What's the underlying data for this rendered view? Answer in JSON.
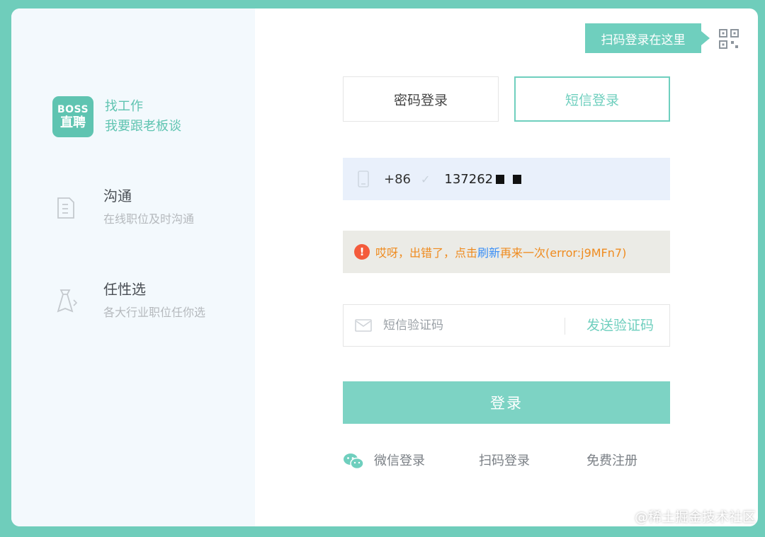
{
  "colors": {
    "accent": "#6fcfbe",
    "error": "#f45b3c",
    "error_text": "#ef8b1f",
    "link": "#3a8ef6"
  },
  "brand": {
    "logo_line1": "BOSS",
    "logo_line2": "直聘",
    "title": "找工作",
    "subtitle": "我要跟老板谈"
  },
  "features": [
    {
      "icon": "document-icon",
      "title": "沟通",
      "desc": "在线职位及时沟通"
    },
    {
      "icon": "necktie-icon",
      "title": "任性选",
      "desc": "各大行业职位任你选"
    }
  ],
  "qr_tip": "扫码登录在这里",
  "tabs": {
    "password": "密码登录",
    "sms": "短信登录",
    "active": "sms"
  },
  "phone": {
    "country_code": "+86",
    "number": "137262"
  },
  "error": {
    "before": "哎呀，出错了，点击",
    "link": "刷新",
    "after": "再来一次(error:j9MFn7)"
  },
  "sms_code": {
    "placeholder": "短信验证码",
    "send_label": "发送验证码"
  },
  "login_label": "登录",
  "links": {
    "wechat": "微信登录",
    "scan": "扫码登录",
    "register": "免费注册"
  },
  "watermark": "@稀土掘金技术社区"
}
